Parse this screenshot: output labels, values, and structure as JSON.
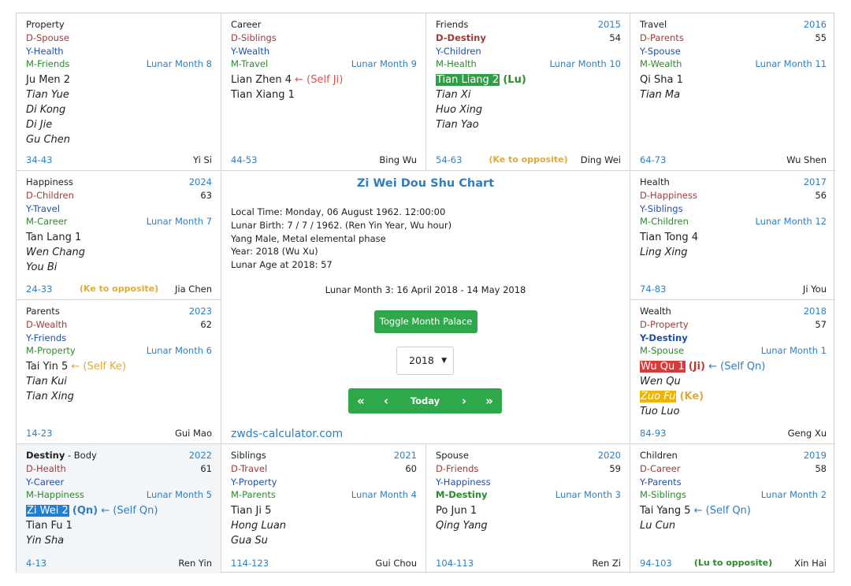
{
  "center": {
    "title": "Zi Wei Dou Shu Chart",
    "info": [
      "Local Time: Monday, 06 August 1962. 12:00:00",
      "Lunar Birth: 7 / 7 / 1962. (Ren Yin Year, Wu hour)",
      "Yang Male, Metal elemental phase",
      "Year: 2018 (Wu Xu)",
      "Lunar Age at 2018: 57"
    ],
    "lunar_month": "Lunar Month 3: 16 April 2018 - 14 May 2018",
    "toggle_label": "Toggle Month Palace",
    "year_select": "2018",
    "nav": {
      "first": "«",
      "prev": "‹",
      "today": "Today",
      "next": "›",
      "last": "»"
    },
    "site": "zwds-calculator.com"
  },
  "palaces": [
    {
      "name": "Property",
      "year": "",
      "age": "",
      "d": "D-Spouse",
      "y": "Y-Health",
      "m": "M-Friends",
      "month": "Lunar Month 8",
      "stars": [
        "Ju Men 2",
        "Tian Yue",
        "Di Kong",
        "Di Jie",
        "Gu Chen"
      ],
      "range": "34-43",
      "note": "",
      "stem": "Yi Si"
    },
    {
      "name": "Career",
      "year": "",
      "age": "",
      "d": "D-Siblings",
      "y": "Y-Wealth",
      "m": "M-Travel",
      "month": "Lunar Month 9",
      "stars": [
        "Lian Zhen 4",
        "Tian Xiang 1"
      ],
      "star0_extra": "← (Self Ji)",
      "range": "44-53",
      "note": "",
      "stem": "Bing Wu"
    },
    {
      "name": "Friends",
      "year": "2015",
      "age": "54",
      "d": "D-Destiny",
      "y": "Y-Children",
      "m": "M-Health",
      "month": "Lunar Month 10",
      "stars": [
        "Tian Liang 2",
        "Tian Xi",
        "Huo Xing",
        "Tian Yao"
      ],
      "star0_extra": "(Lu)",
      "range": "54-63",
      "note": "(Ke to opposite)",
      "stem": "Ding Wei"
    },
    {
      "name": "Travel",
      "year": "2016",
      "age": "55",
      "d": "D-Parents",
      "y": "Y-Spouse",
      "m": "M-Wealth",
      "month": "Lunar Month 11",
      "stars": [
        "Qi Sha 1",
        "Tian Ma"
      ],
      "range": "64-73",
      "note": "",
      "stem": "Wu Shen"
    },
    {
      "name": "Happiness",
      "year": "2024",
      "age": "63",
      "d": "D-Children",
      "y": "Y-Travel",
      "m": "M-Career",
      "month": "Lunar Month 7",
      "stars": [
        "Tan Lang 1",
        "Wen Chang",
        "You Bi"
      ],
      "range": "24-33",
      "note": "(Ke to opposite)",
      "stem": "Jia Chen"
    },
    {
      "name": "Health",
      "year": "2017",
      "age": "56",
      "d": "D-Happiness",
      "y": "Y-Siblings",
      "m": "M-Children",
      "month": "Lunar Month 12",
      "stars": [
        "Tian Tong 4",
        "Ling Xing"
      ],
      "range": "74-83",
      "note": "",
      "stem": "Ji You"
    },
    {
      "name": "Parents",
      "year": "2023",
      "age": "62",
      "d": "D-Wealth",
      "y": "Y-Friends",
      "m": "M-Property",
      "month": "Lunar Month 6",
      "stars": [
        "Tai Yin 5",
        "Tian Kui",
        "Tian Xing"
      ],
      "star0_extra": "← (Self Ke)",
      "range": "14-23",
      "note": "",
      "stem": "Gui Mao"
    },
    {
      "name": "Wealth",
      "year": "2018",
      "age": "57",
      "d": "D-Property",
      "y": "Y-Destiny",
      "m": "M-Spouse",
      "month": "Lunar Month 1",
      "stars": [
        "Wu Qu 1",
        "Wen Qu",
        "Zuo Fu",
        "Tuo Luo"
      ],
      "star0_extra": "(Ji)",
      "star0_extra2": "← (Self Qn)",
      "star2_extra": "(Ke)",
      "range": "84-93",
      "note": "",
      "stem": "Geng Xu"
    },
    {
      "name": "Destiny",
      "name_suffix": "- Body",
      "year": "2022",
      "age": "61",
      "d": "D-Health",
      "y": "Y-Career",
      "m": "M-Happiness",
      "month": "Lunar Month 5",
      "stars": [
        "Zi Wei 2",
        "Tian Fu 1",
        "Yin Sha"
      ],
      "star0_extra": "(Qn)",
      "star0_extra2": "← (Self Qn)",
      "range": "4-13",
      "note": "",
      "stem": "Ren Yin"
    },
    {
      "name": "Siblings",
      "year": "2021",
      "age": "60",
      "d": "D-Travel",
      "y": "Y-Property",
      "m": "M-Parents",
      "month": "Lunar Month 4",
      "stars": [
        "Tian Ji 5",
        "Hong Luan",
        "Gua Su"
      ],
      "range": "114-123",
      "note": "",
      "stem": "Gui Chou"
    },
    {
      "name": "Spouse",
      "year": "2020",
      "age": "59",
      "d": "D-Friends",
      "y": "Y-Happiness",
      "m": "M-Destiny",
      "month": "Lunar Month 3",
      "stars": [
        "Po Jun 1",
        "Qing Yang"
      ],
      "range": "104-113",
      "note": "",
      "stem": "Ren Zi"
    },
    {
      "name": "Children",
      "year": "2019",
      "age": "58",
      "d": "D-Career",
      "y": "Y-Parents",
      "m": "M-Siblings",
      "month": "Lunar Month 2",
      "stars": [
        "Tai Yang 5",
        "Lu Cun"
      ],
      "star0_extra": "← (Self Qn)",
      "range": "94-103",
      "note": "(Lu to opposite)",
      "stem": "Xin Hai"
    }
  ],
  "colors": {
    "accent": "#2f7fc0",
    "green": "#2ea84a",
    "gold": "#e0a93a",
    "red_highlight": "#d93a3a",
    "blue_highlight": "#1f7fd6"
  }
}
